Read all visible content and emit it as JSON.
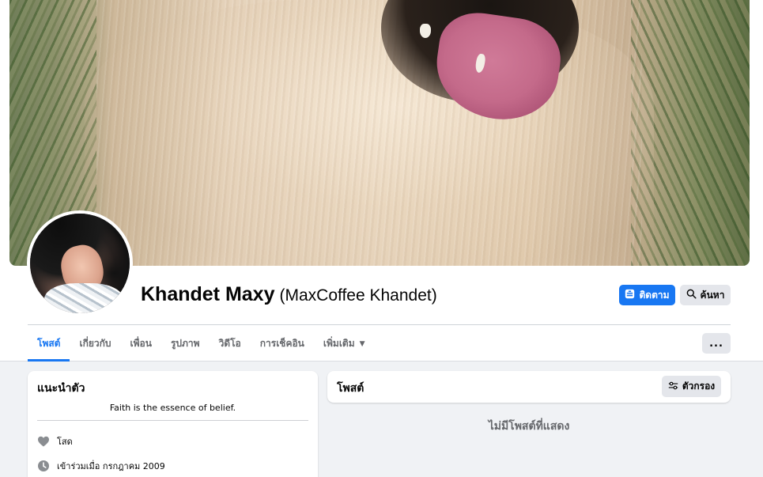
{
  "profile": {
    "name": "Khandet Maxy",
    "alternate_name": "(MaxCoffee Khandet)"
  },
  "actions": {
    "follow_label": "ติดตาม",
    "search_label": "ค้นหา",
    "more_label": "..."
  },
  "tabs": [
    {
      "label": "โพสต์",
      "active": true
    },
    {
      "label": "เกี่ยวกับ",
      "active": false
    },
    {
      "label": "เพื่อน",
      "active": false
    },
    {
      "label": "รูปภาพ",
      "active": false
    },
    {
      "label": "วิดีโอ",
      "active": false
    },
    {
      "label": "การเช็คอิน",
      "active": false
    },
    {
      "label": "เพิ่มเติม",
      "active": false
    }
  ],
  "intro": {
    "title": "แนะนำตัว",
    "bio": "Faith is the essence of belief.",
    "items": [
      {
        "icon": "heart-icon",
        "text": "โสด"
      },
      {
        "icon": "clock-icon",
        "text": "เข้าร่วมเมื่อ กรกฎาคม 2009"
      }
    ]
  },
  "posts": {
    "title": "โพสต์",
    "filter_label": "ตัวกรอง",
    "empty_message": "ไม่มีโพสต์ที่แสดง"
  },
  "colors": {
    "accent": "#1877f2",
    "background": "#f0f2f5",
    "secondary_button": "#e4e6eb",
    "muted_text": "#65676b"
  }
}
